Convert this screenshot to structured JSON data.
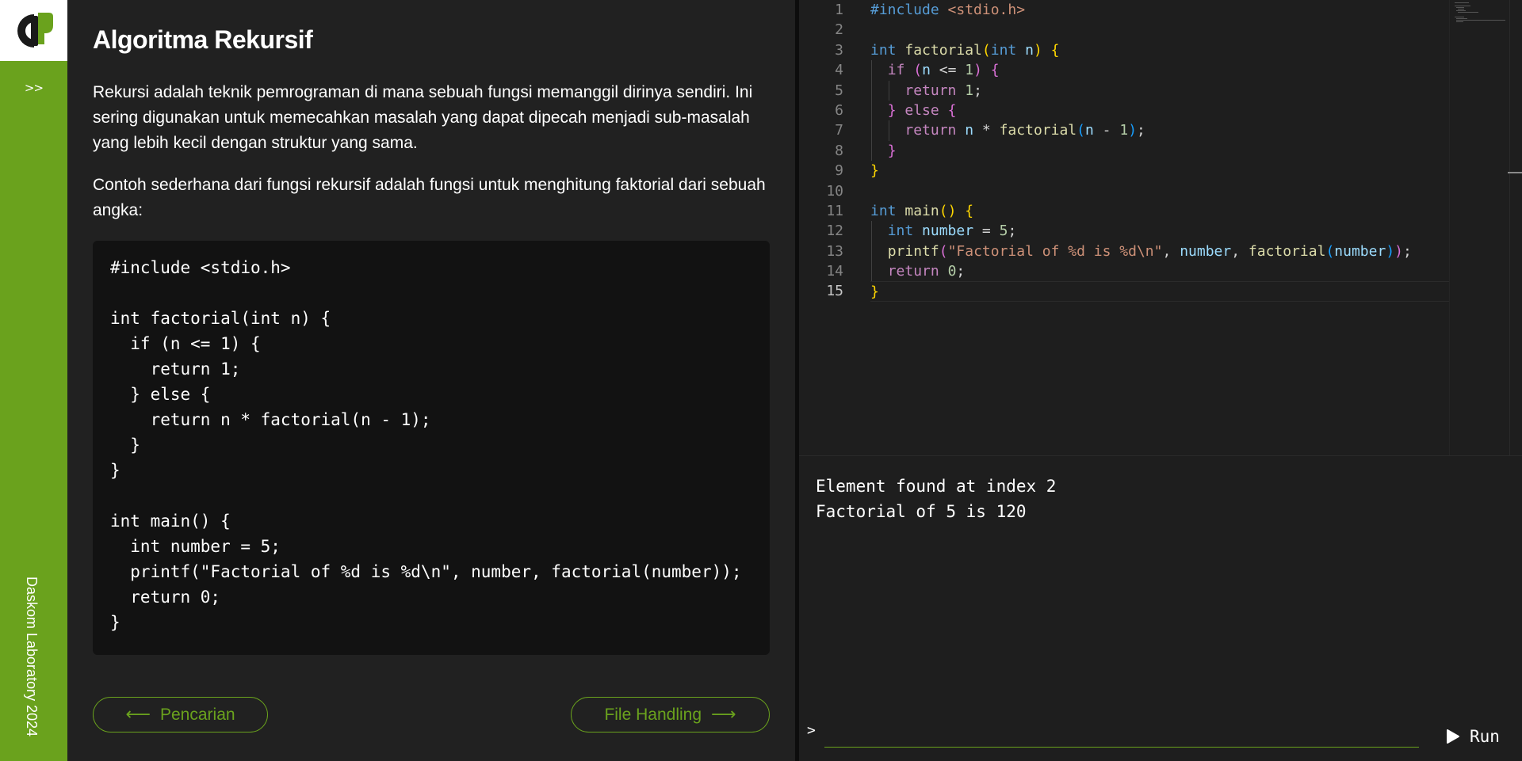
{
  "sidebar": {
    "expand_label": ">>",
    "footer_text": "Daskom Laboratory 2024",
    "brand_color": "#6aa21d"
  },
  "content": {
    "title": "Algoritma Rekursif",
    "paragraph1": "Rekursi adalah teknik pemrograman di mana sebuah fungsi memanggil dirinya sendiri. Ini sering digunakan untuk memecahkan masalah yang dapat dipecah menjadi sub-masalah yang lebih kecil dengan struktur yang sama.",
    "paragraph2": "Contoh sederhana dari fungsi rekursif adalah fungsi untuk menghitung faktorial dari sebuah angka:",
    "code_example": "#include <stdio.h>\n\nint factorial(int n) {\n  if (n <= 1) {\n    return 1;\n  } else {\n    return n * factorial(n - 1);\n  }\n}\n\nint main() {\n  int number = 5;\n  printf(\"Factorial of %d is %d\\n\", number, factorial(number));\n  return 0;\n}",
    "prev_button": "Pencarian",
    "next_button": "File Handling"
  },
  "editor": {
    "line_numbers": [
      "1",
      "2",
      "3",
      "4",
      "5",
      "6",
      "7",
      "8",
      "9",
      "10",
      "11",
      "12",
      "13",
      "14",
      "15"
    ],
    "active_line": 15,
    "lines": [
      "#include <stdio.h>",
      "",
      "int factorial(int n) {",
      "  if (n <= 1) {",
      "    return 1;",
      "  } else {",
      "    return n * factorial(n - 1);",
      "  }",
      "}",
      "",
      "int main() {",
      "  int number = 5;",
      "  printf(\"Factorial of %d is %d\\n\", number, factorial(number));",
      "  return 0;",
      "}"
    ]
  },
  "console": {
    "output": "Element found at index 2\nFactorial of 5 is 120",
    "prompt": ">",
    "input_value": "",
    "run_label": "Run"
  }
}
